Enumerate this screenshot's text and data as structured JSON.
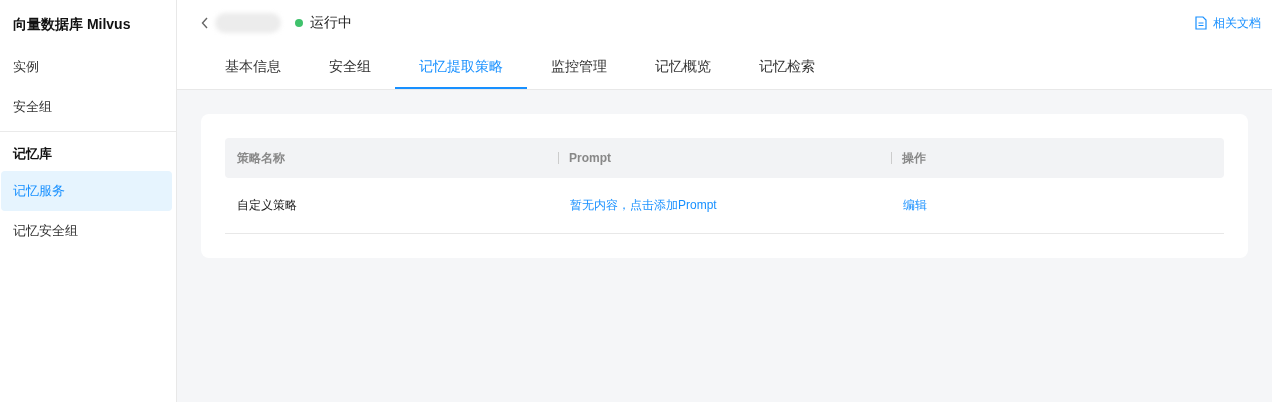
{
  "sidebar": {
    "title": "向量数据库 Milvus",
    "items": [
      {
        "kind": "item",
        "label": "实例",
        "selected": false
      },
      {
        "kind": "item",
        "label": "安全组",
        "selected": false
      },
      {
        "kind": "divider"
      },
      {
        "kind": "section",
        "label": "记忆库"
      },
      {
        "kind": "item",
        "label": "记忆服务",
        "selected": true
      },
      {
        "kind": "item",
        "label": "记忆安全组",
        "selected": false
      }
    ]
  },
  "header": {
    "status": {
      "label": "运行中",
      "color": "#3fc26c"
    },
    "docs_link": "相关文档"
  },
  "tabs": [
    {
      "label": "基本信息",
      "selected": false
    },
    {
      "label": "安全组",
      "selected": false
    },
    {
      "label": "记忆提取策略",
      "selected": true
    },
    {
      "label": "监控管理",
      "selected": false
    },
    {
      "label": "记忆概览",
      "selected": false
    },
    {
      "label": "记忆检索",
      "selected": false
    }
  ],
  "table": {
    "columns": [
      "策略名称",
      "Prompt",
      "操作"
    ],
    "rows": [
      {
        "name": "自定义策略",
        "prompt": "暂无内容，点击添加Prompt",
        "action": "编辑"
      }
    ]
  }
}
